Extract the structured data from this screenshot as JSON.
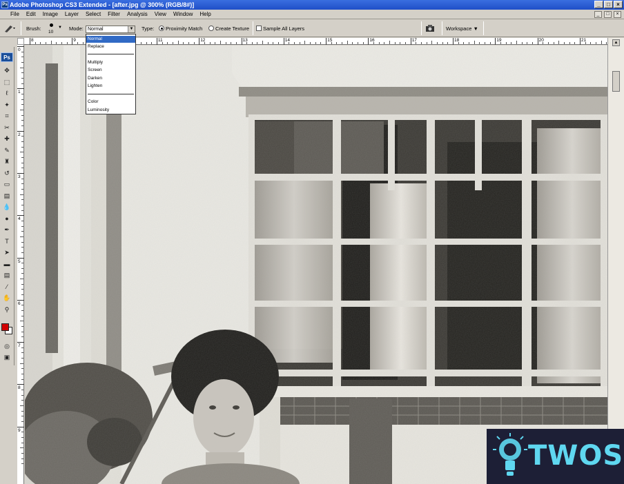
{
  "window": {
    "title": "Adobe Photoshop CS3 Extended - [after.jpg @ 300% (RGB/8#)]",
    "controls": [
      "_",
      "□",
      "×"
    ]
  },
  "menu": {
    "items": [
      "File",
      "Edit",
      "Image",
      "Layer",
      "Select",
      "Filter",
      "Analysis",
      "View",
      "Window",
      "Help"
    ]
  },
  "options": {
    "brush_label": "Brush:",
    "brush_size": "10",
    "mode_label": "Mode:",
    "mode_value": "Normal",
    "type_label": "Type:",
    "type_options": [
      "Proximity Match",
      "Create Texture"
    ],
    "type_selected": "Proximity Match",
    "sample_all_layers": "Sample All Layers",
    "workspace": "Workspace ▼"
  },
  "mode_dropdown": {
    "group1": [
      "Normal",
      "Replace"
    ],
    "group2": [
      "Multiply",
      "Screen",
      "Darken",
      "Lighten"
    ],
    "group3": [
      "Color",
      "Luminosity"
    ],
    "selected": "Normal"
  },
  "toolbox": {
    "logo": "Ps",
    "foreground_color": "#d20000",
    "background_color": "#ffffff",
    "tools": [
      "move-icon",
      "marquee-icon",
      "lasso-icon",
      "magic-wand-icon",
      "crop-icon",
      "slice-icon",
      "spot-healing-icon",
      "brush-icon",
      "clone-stamp-icon",
      "history-brush-icon",
      "eraser-icon",
      "gradient-icon",
      "blur-icon",
      "dodge-icon",
      "pen-icon",
      "type-icon",
      "path-selection-icon",
      "shape-icon",
      "notes-icon",
      "eyedropper-icon",
      "hand-icon",
      "zoom-icon"
    ]
  },
  "rulers": {
    "top": [
      "8",
      "9",
      "10",
      "11",
      "12",
      "13",
      "14",
      "15",
      "16",
      "17",
      "18",
      "19",
      "20",
      "21"
    ],
    "left": [
      "0",
      "1",
      "2",
      "3",
      "4",
      "5",
      "6",
      "7",
      "8",
      "9"
    ]
  },
  "watermark": {
    "text": "TWOS",
    "accent": "#5fd7f0"
  }
}
